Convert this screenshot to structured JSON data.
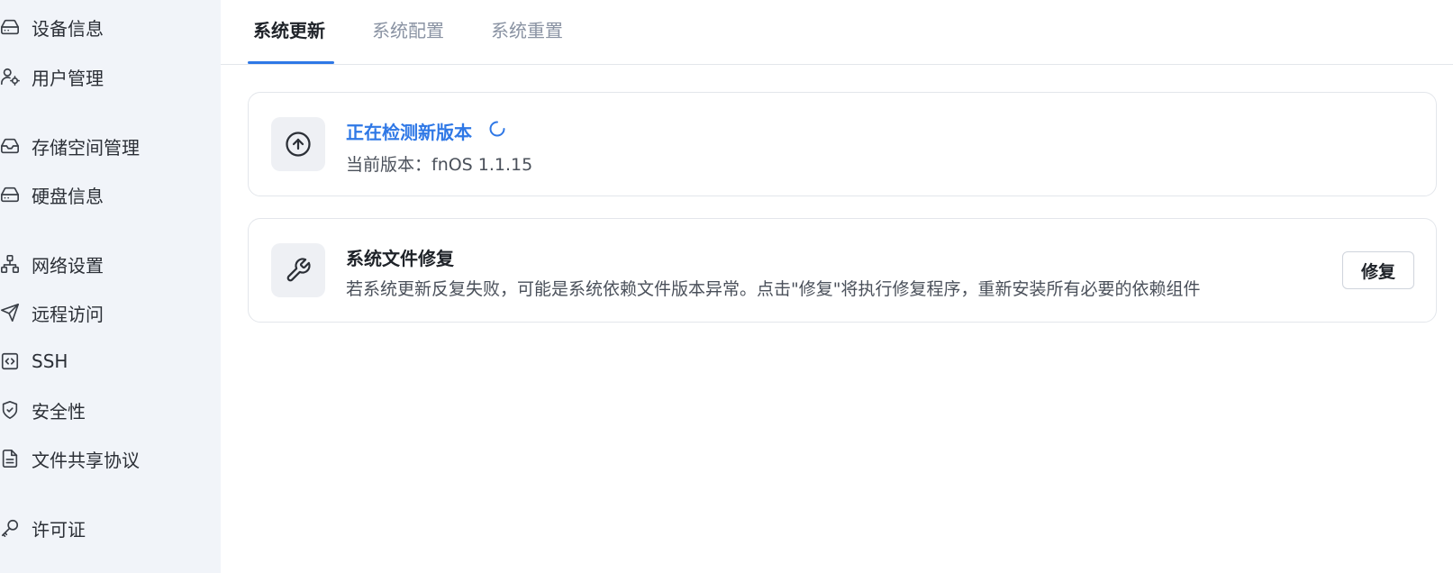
{
  "sidebar": {
    "items": [
      {
        "label": "设备信息",
        "icon": "device-icon"
      },
      {
        "label": "用户管理",
        "icon": "user-manage-icon"
      },
      {
        "label": "存储空间管理",
        "icon": "storage-icon"
      },
      {
        "label": "硬盘信息",
        "icon": "disk-icon"
      },
      {
        "label": "网络设置",
        "icon": "network-icon"
      },
      {
        "label": "远程访问",
        "icon": "send-icon"
      },
      {
        "label": "SSH",
        "icon": "code-icon"
      },
      {
        "label": "安全性",
        "icon": "shield-icon"
      },
      {
        "label": "文件共享协议",
        "icon": "document-icon"
      },
      {
        "label": "许可证",
        "icon": "key-icon"
      }
    ]
  },
  "tabs": [
    {
      "label": "系统更新",
      "active": true
    },
    {
      "label": "系统配置",
      "active": false
    },
    {
      "label": "系统重置",
      "active": false
    }
  ],
  "update_card": {
    "title": "正在检测新版本",
    "current_version": "当前版本：fnOS 1.1.15",
    "icon": "arrow-up-circle-icon"
  },
  "repair_card": {
    "title": "系统文件修复",
    "description": "若系统更新反复失败，可能是系统依赖文件版本异常。点击\"修复\"将执行修复程序，重新安装所有必要的依赖组件",
    "button_label": "修复",
    "icon": "wrench-icon"
  },
  "colors": {
    "accent": "#2f78e6",
    "sidebar_bg": "#f1f4f9"
  }
}
